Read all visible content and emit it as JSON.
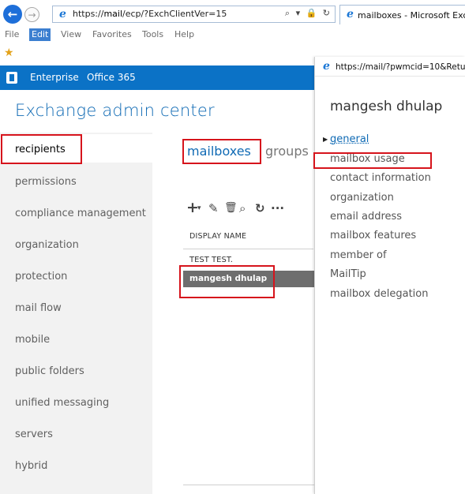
{
  "browser": {
    "address_url_prefix": "https://",
    "address_url_host": "mail",
    "address_url_path": "/ecp/?ExchClientVer=15",
    "address_tools": "⌕ ▾ 🔒 ↻",
    "tab_title": "mailboxes - Microsoft Exch",
    "menu": [
      "File",
      "Edit",
      "View",
      "Favorites",
      "Tools",
      "Help"
    ]
  },
  "header": {
    "enterprise": "Enterprise",
    "office365": "Office 365"
  },
  "eac": {
    "title": "Exchange admin center",
    "nav": [
      "recipients",
      "permissions",
      "compliance management",
      "organization",
      "protection",
      "mail flow",
      "mobile",
      "public folders",
      "unified messaging",
      "servers",
      "hybrid"
    ],
    "selected_nav": "recipients",
    "tabs": {
      "mailboxes": "mailboxes",
      "groups": "groups"
    },
    "toolbar": {
      "add": "+",
      "add_menu": "▾",
      "edit": "✎",
      "delete": "🗑",
      "search": "⌕",
      "refresh": "↻",
      "more": "···"
    },
    "table": {
      "column": "DISPLAY NAME",
      "rows": [
        "TEST TEST.",
        "mangesh dhulap"
      ]
    }
  },
  "popup": {
    "url": "https://mail/?pwmcid=10&Retu",
    "title": "mangesh dhulap",
    "nav": [
      "general",
      "mailbox usage",
      "contact information",
      "organization",
      "email address",
      "mailbox features",
      "member of",
      "MailTip",
      "mailbox delegation"
    ]
  },
  "colors": {
    "o365_blue": "#0b72c6",
    "eac_blue": "#0f6ab4",
    "highlight_red": "#d6141c",
    "selected_row": "#6e6e6e"
  }
}
